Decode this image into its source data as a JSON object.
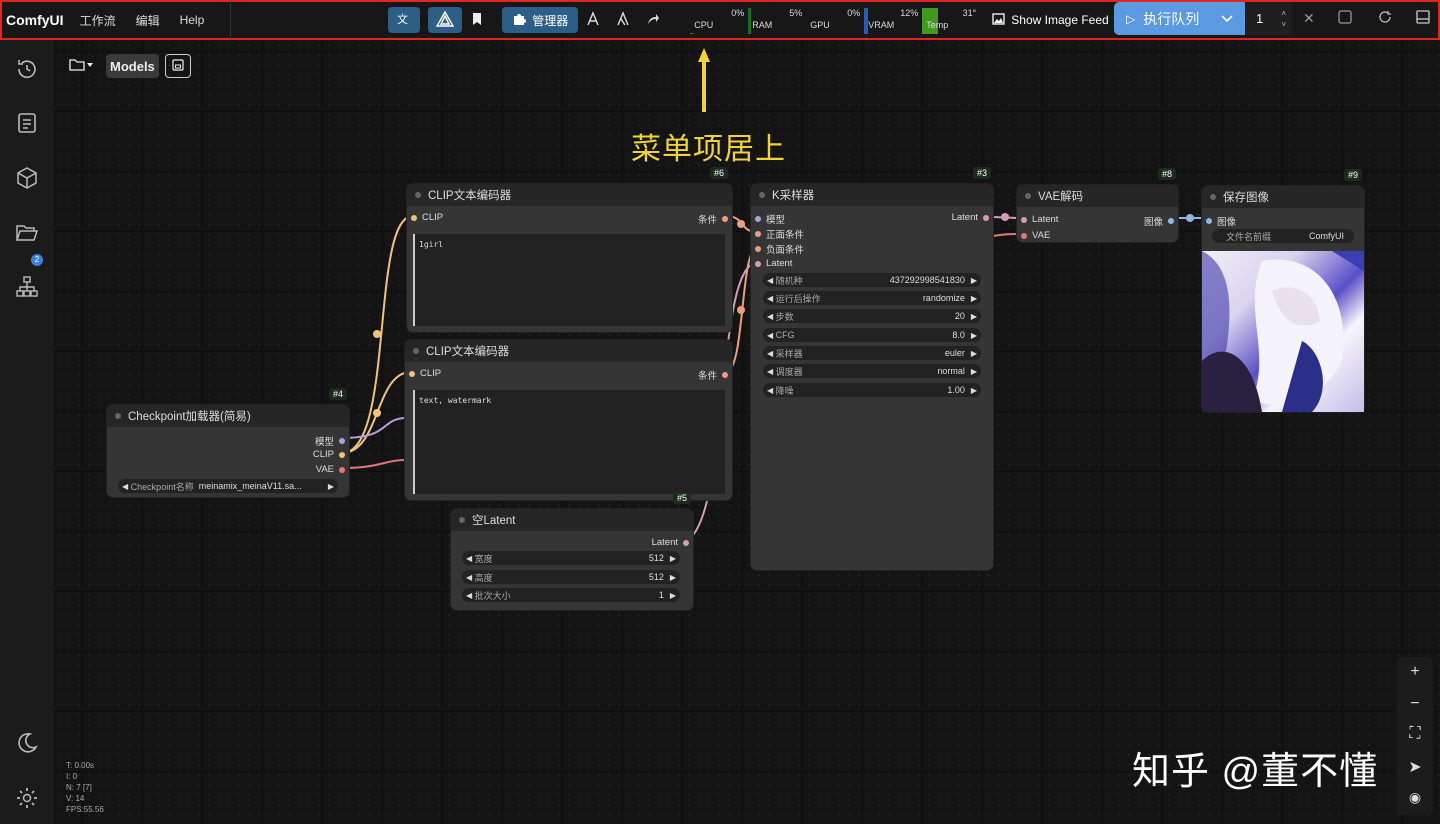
{
  "topbar": {
    "brand": "ComfyUI",
    "menu": [
      "工作流",
      "编辑",
      "Help"
    ],
    "manager_label": "管理器",
    "stats": [
      {
        "label": "CPU",
        "value": "0%",
        "fill": 0.0
      },
      {
        "label": "RAM",
        "value": "5%",
        "fill": 0.05
      },
      {
        "label": "GPU",
        "value": "0%",
        "fill": 0.0
      },
      {
        "label": "VRAM",
        "value": "12%",
        "fill": 0.12
      },
      {
        "label": "Temp",
        "value": "31°",
        "fill": 0.31
      }
    ],
    "feed_label": "Show Image Feed 🐍",
    "queue_label": "执行队列",
    "queue_count": "1"
  },
  "workspace": {
    "models_label": "Models"
  },
  "sidebar": {
    "badge": "2"
  },
  "annotation": "菜单项居上",
  "nodes": {
    "clip_pos": {
      "id": "#6",
      "title": "CLIP文本编码器",
      "in": "CLIP",
      "out": "条件",
      "text": "1girl"
    },
    "clip_neg": {
      "title": "CLIP文本编码器",
      "in": "CLIP",
      "out": "条件",
      "text": "text, watermark"
    },
    "ksampler": {
      "id": "#3",
      "title": "K采样器",
      "inputs": [
        "模型",
        "正面条件",
        "负面条件",
        "Latent"
      ],
      "out": "Latent",
      "widgets": [
        {
          "label": "随机种",
          "value": "437292998541830"
        },
        {
          "label": "运行后操作",
          "value": "randomize"
        },
        {
          "label": "步数",
          "value": "20"
        },
        {
          "label": "CFG",
          "value": "8.0"
        },
        {
          "label": "采样器",
          "value": "euler"
        },
        {
          "label": "调度器",
          "value": "normal"
        },
        {
          "label": "降噪",
          "value": "1.00"
        }
      ]
    },
    "vae": {
      "id": "#8",
      "title": "VAE解码",
      "in1": "Latent",
      "in2": "VAE",
      "out": "图像"
    },
    "save": {
      "id": "#9",
      "title": "保存图像",
      "in": "图像",
      "prefix_label": "文件名前缀",
      "prefix_value": "ComfyUI"
    },
    "ckpt": {
      "id": "#4",
      "title": "Checkpoint加载器(简易)",
      "outs": [
        "模型",
        "CLIP",
        "VAE"
      ],
      "widget_label": "Checkpoint名称",
      "widget_value": "meinamix_meinaV11.sa..."
    },
    "latent": {
      "id": "#5",
      "title": "空Latent",
      "out": "Latent",
      "widgets": [
        {
          "label": "宽度",
          "value": "512"
        },
        {
          "label": "高度",
          "value": "512"
        },
        {
          "label": "批次大小",
          "value": "1"
        }
      ]
    }
  },
  "stats_overlay": [
    "T: 0.00s",
    "I: 0",
    "N: 7 [7]",
    "V: 14",
    "FPS:55.56"
  ],
  "watermark": "知乎 @董不懂",
  "colors": {
    "accent": "#5b9ae0",
    "highlight": "#e0261f",
    "annotation": "#f3d33a"
  }
}
